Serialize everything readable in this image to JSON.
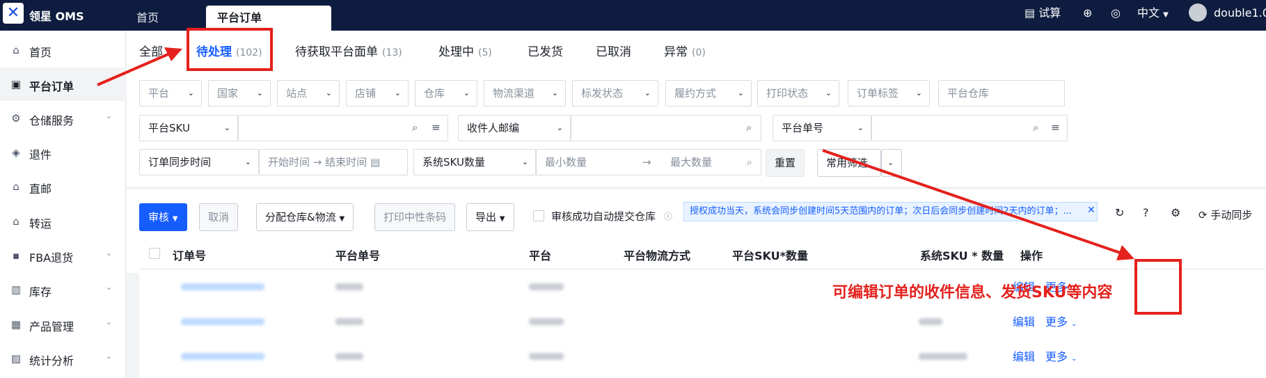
{
  "topbar": {
    "brand": "领星 OMS",
    "tabs": [
      "首页",
      "平台订单"
    ],
    "trial": "试算",
    "language": "中文",
    "user": "double1.0"
  },
  "sidebar": {
    "items": [
      {
        "label": "首页",
        "icon": "home-icon"
      },
      {
        "label": "平台订单",
        "icon": "order-icon"
      },
      {
        "label": "仓储服务",
        "icon": "warehouse-icon"
      },
      {
        "label": "退件",
        "icon": "return-icon"
      },
      {
        "label": "直邮",
        "icon": "mail-icon"
      },
      {
        "label": "转运",
        "icon": "transfer-icon"
      },
      {
        "label": "FBA退货",
        "icon": "fba-icon"
      },
      {
        "label": "库存",
        "icon": "inventory-icon"
      },
      {
        "label": "产品管理",
        "icon": "product-icon"
      },
      {
        "label": "统计分析",
        "icon": "stats-icon"
      }
    ]
  },
  "status_tabs": [
    {
      "label": "全部",
      "count": ""
    },
    {
      "label": "待处理",
      "count": "(102)"
    },
    {
      "label": "待获取平台面单",
      "count": "(13)"
    },
    {
      "label": "处理中",
      "count": "(5)"
    },
    {
      "label": "已发货",
      "count": ""
    },
    {
      "label": "已取消",
      "count": ""
    },
    {
      "label": "异常",
      "count": "(0)"
    }
  ],
  "filters": {
    "row1": [
      "平台",
      "国家",
      "站点",
      "店铺",
      "仓库",
      "物流渠道",
      "标发状态",
      "履约方式",
      "打印状态",
      "订单标签"
    ],
    "platform_warehouse_placeholder": "平台仓库",
    "platform_sku": "平台SKU",
    "recipient_zip": "收件人邮编",
    "platform_order_no": "平台单号",
    "order_sync_time": "订单同步时间",
    "start_time": "开始时间",
    "end_time": "结束时间",
    "system_sku_qty": "系统SKU数量",
    "min_qty": "最小数量",
    "max_qty": "最大数量",
    "reset": "重置",
    "common_filter": "常用筛选"
  },
  "actions": {
    "review": "审核",
    "cancel": "取消",
    "assign": "分配仓库&物流",
    "print_label": "打印中性条码",
    "export": "导出",
    "auto_submit": "审核成功自动提交仓库",
    "notice": "授权成功当天，系统会同步创建时间5天范围内的订单；次日后会同步创建时间2天内的订单；...",
    "manual_sync": "手动同步"
  },
  "table": {
    "headers": [
      "订单号",
      "平台单号",
      "平台",
      "平台物流方式",
      "平台SKU*数量",
      "系统SKU * 数量",
      "操作"
    ],
    "rows": [
      {
        "edit": "编辑",
        "more": "更多"
      },
      {
        "edit": "编辑",
        "more": "更多"
      },
      {
        "edit": "编辑",
        "more": "更多"
      }
    ]
  },
  "annotation": {
    "text": "可编辑订单的收件信息、发货SKU等内容"
  },
  "colors": {
    "accent": "#165dff",
    "topbar": "#0e1c3f",
    "annotation": "#e4211d"
  }
}
